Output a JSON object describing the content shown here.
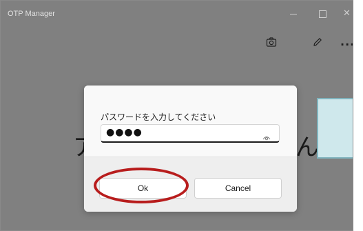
{
  "window": {
    "title": "OTP Manager",
    "controls": [
      "minimize",
      "maximize",
      "close"
    ],
    "close_glyph": "✕"
  },
  "toolbar": {
    "icons": [
      "camera-icon",
      "pencil-icon",
      "more-icon"
    ],
    "more_glyph": "···"
  },
  "background": {
    "left_text": "ア",
    "right_text": "ん"
  },
  "dialog": {
    "prompt": "パスワードを入力してください",
    "password_value": "●●●●",
    "ok_label": "Ok",
    "cancel_label": "Cancel"
  },
  "colors": {
    "window_bg": "#808080",
    "dialog_bg": "#f9f9f9",
    "footer_bg": "#eeeeee",
    "highlight": "#b81d1d",
    "arrow_fill": "#cfe8ec",
    "arrow_stroke": "#7fb3bd"
  }
}
